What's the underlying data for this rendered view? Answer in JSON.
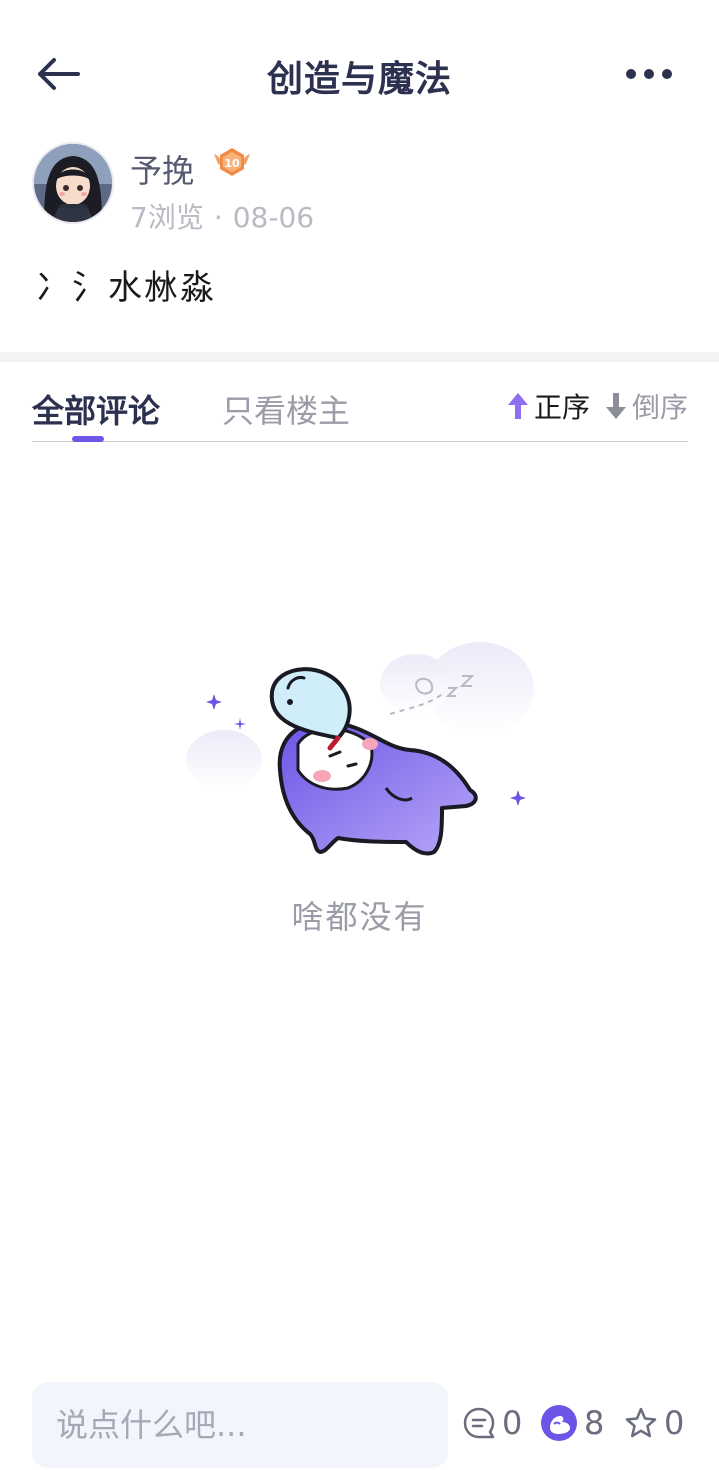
{
  "header": {
    "title": "创造与魔法",
    "back_icon": "arrow-left-icon",
    "more_icon": "more-horizontal-icon"
  },
  "author": {
    "name": "予挽",
    "level": "10",
    "views": "7浏览",
    "separator": "·",
    "date": "08-06"
  },
  "post": {
    "text": "冫氵水沝淼"
  },
  "comments": {
    "tabs": [
      {
        "label": "全部评论",
        "active": true
      },
      {
        "label": "只看楼主",
        "active": false
      }
    ],
    "sort": {
      "asc_label": "正序",
      "desc_label": "倒序",
      "active": "asc"
    },
    "empty_text": "啥都没有"
  },
  "bottom_bar": {
    "input_placeholder": "说点什么吧...",
    "comment_count": "0",
    "like_count": "8",
    "favorite_count": "0"
  },
  "colors": {
    "accent": "#6c56e8",
    "title": "#2c3150",
    "muted": "#9a9ca8",
    "input_bg": "#f3f5fc"
  }
}
